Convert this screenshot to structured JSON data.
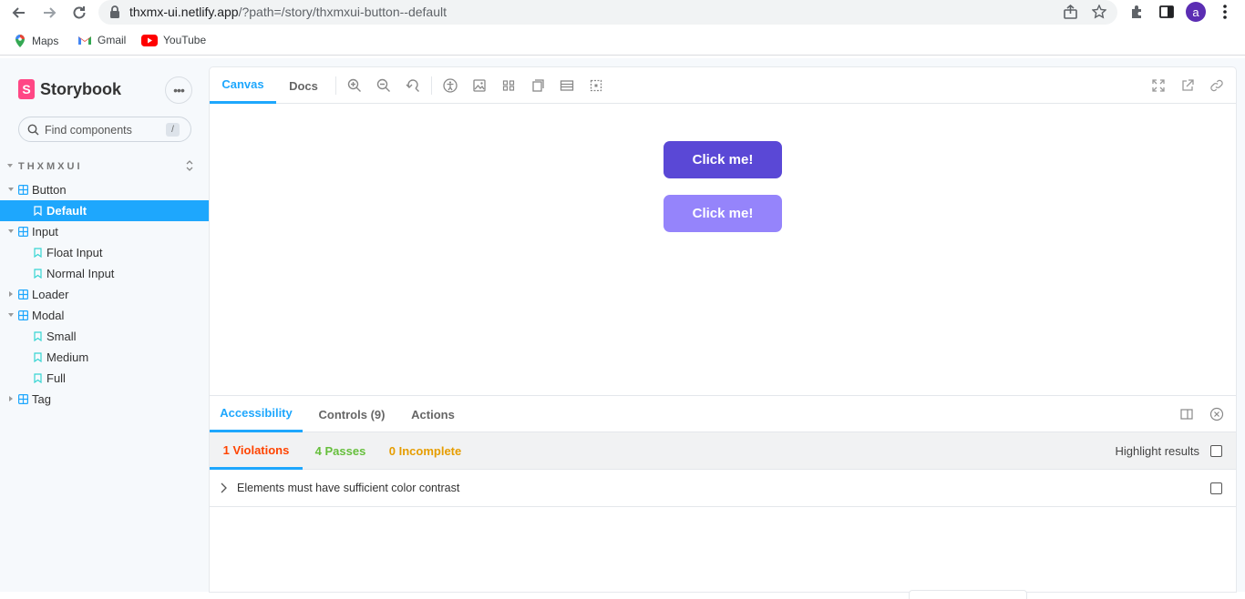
{
  "browser": {
    "url_host": "thxmx-ui.netlify.app",
    "url_path": "/?path=/story/thxmxui-button--default",
    "avatar_letter": "a",
    "bookmarks": [
      {
        "label": "Maps",
        "icon": "maps-pin-icon"
      },
      {
        "label": "Gmail",
        "icon": "gmail-icon"
      },
      {
        "label": "YouTube",
        "icon": "youtube-icon"
      }
    ]
  },
  "sidebar": {
    "brand": "Storybook",
    "menu_label": "•••",
    "search_placeholder": "Find components",
    "search_shortcut": "/",
    "group_label": "THXMXUI",
    "tree": [
      {
        "type": "component",
        "label": "Button",
        "expanded": true
      },
      {
        "type": "story",
        "label": "Default",
        "selected": true
      },
      {
        "type": "component",
        "label": "Input",
        "expanded": true
      },
      {
        "type": "story",
        "label": "Float Input"
      },
      {
        "type": "story",
        "label": "Normal Input"
      },
      {
        "type": "component",
        "label": "Loader",
        "expanded": false
      },
      {
        "type": "component",
        "label": "Modal",
        "expanded": true
      },
      {
        "type": "story",
        "label": "Small"
      },
      {
        "type": "story",
        "label": "Medium"
      },
      {
        "type": "story",
        "label": "Full"
      },
      {
        "type": "component",
        "label": "Tag",
        "expanded": false
      }
    ]
  },
  "toolbar": {
    "tabs": [
      {
        "label": "Canvas",
        "active": true
      },
      {
        "label": "Docs",
        "active": false
      }
    ]
  },
  "canvas": {
    "primary_button": {
      "label": "Click me!",
      "color": "#5a48d6"
    },
    "secondary_button": {
      "label": "Click me!",
      "color": "#9584fb"
    }
  },
  "addons": {
    "tabs": [
      {
        "label": "Accessibility",
        "active": true
      },
      {
        "label": "Controls (9)",
        "active": false
      },
      {
        "label": "Actions",
        "active": false
      }
    ],
    "results": [
      {
        "label": "1 Violations",
        "color": "#ff4400",
        "active": true
      },
      {
        "label": "4 Passes",
        "color": "#66bf3c"
      },
      {
        "label": "0 Incomplete",
        "color": "#e69d00"
      }
    ],
    "highlight_label": "Highlight results",
    "violation_text": "Elements must have sufficient color contrast"
  },
  "colors": {
    "accent": "#1ea7fd",
    "brand": "#ff4785"
  }
}
